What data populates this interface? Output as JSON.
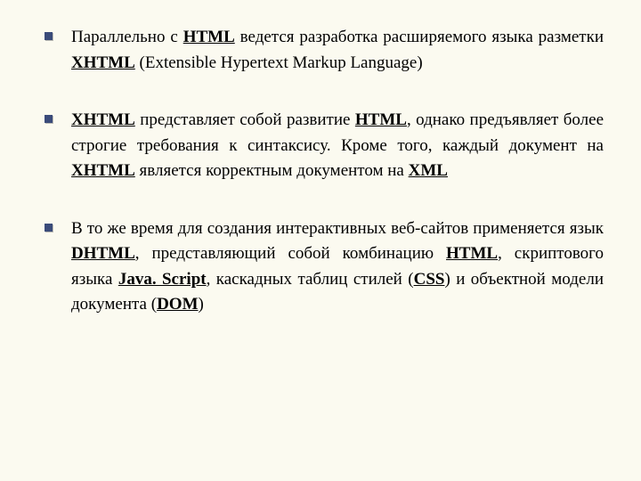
{
  "bullets": {
    "b1": {
      "t1": "Параллельно с ",
      "html": "HTML",
      "t2": " ведется разработка расширяемого языка разметки ",
      "xhtml": "XHTML",
      "t3": " (Extensible Hypertext Markup Language)"
    },
    "b2": {
      "xhtml": "XHTML",
      "t1": " представляет собой развитие ",
      "html": "HTML",
      "t2": ", однако предъявляет более строгие требования к синтаксису. Кроме того, каждый документ на ",
      "xhtml2": "XHTML",
      "t3": " является корректным документом на ",
      "xml": "XML"
    },
    "b3": {
      "t1": "В то же время для создания интерактивных веб-сайтов применяется язык ",
      "dhtml": "DHTML",
      "t2": ", представляющий собой комбинацию ",
      "html": "HTML",
      "t3": ", скриптового языка ",
      "js": "Java. Script",
      "t4": ", каскадных таблиц стилей (",
      "css": "CSS",
      "t5": ") и объектной модели документа (",
      "dom": "DOM",
      "t6": ")"
    }
  }
}
